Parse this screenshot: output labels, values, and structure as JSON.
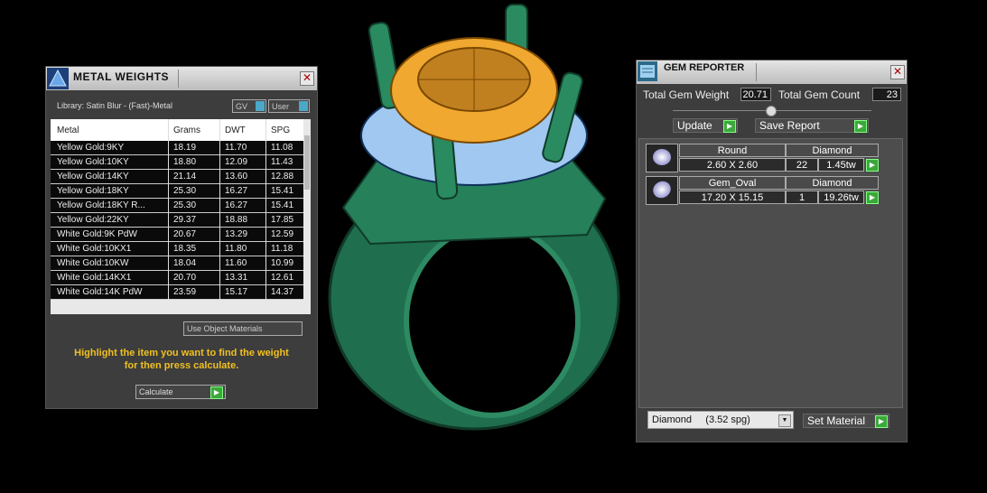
{
  "metal_weights": {
    "title": "METAL WEIGHTS",
    "library": "Library: Satin Blur - (Fast)-Metal",
    "gv_label": "GV",
    "user_label": "User",
    "columns": [
      "Metal",
      "Grams",
      "DWT",
      "SPG"
    ],
    "rows": [
      [
        "Yellow Gold:9KY",
        "18.19",
        "11.70",
        "11.08"
      ],
      [
        "Yellow Gold:10KY",
        "18.80",
        "12.09",
        "11.43"
      ],
      [
        "Yellow Gold:14KY",
        "21.14",
        "13.60",
        "12.88"
      ],
      [
        "Yellow Gold:18KY",
        "25.30",
        "16.27",
        "15.41"
      ],
      [
        "Yellow Gold:18KY R...",
        "25.30",
        "16.27",
        "15.41"
      ],
      [
        "Yellow Gold:22KY",
        "29.37",
        "18.88",
        "17.85"
      ],
      [
        "White Gold:9K PdW",
        "20.67",
        "13.29",
        "12.59"
      ],
      [
        "White Gold:10KX1",
        "18.35",
        "11.80",
        "11.18"
      ],
      [
        "White Gold:10KW",
        "18.04",
        "11.60",
        "10.99"
      ],
      [
        "White Gold:14KX1",
        "20.70",
        "13.31",
        "12.61"
      ],
      [
        "White Gold:14K PdW",
        "23.59",
        "15.17",
        "14.37"
      ]
    ],
    "use_object_materials": "Use Object Materials",
    "help_line1": "Highlight the item you want to find the weight",
    "help_line2": "for then press calculate.",
    "calculate_label": "Calculate"
  },
  "gem_reporter": {
    "title": "GEM REPORTER",
    "total_weight_label": "Total Gem Weight",
    "total_weight_value": "20.71",
    "total_count_label": "Total Gem Count",
    "total_count_value": "23",
    "update_label": "Update",
    "save_report_label": "Save Report",
    "gems": [
      {
        "shape": "Round",
        "material": "Diamond",
        "size": "2.60 X 2.60",
        "count": "22",
        "weight": "1.45tw"
      },
      {
        "shape": "Gem_Oval",
        "material": "Diamond",
        "size": "17.20 X 15.15",
        "count": "1",
        "weight": "19.26tw"
      }
    ],
    "material_select": "Diamond     (3.52 spg)",
    "set_material_label": "Set Material"
  },
  "colors": {
    "ring_green": "#1f6e4e",
    "gem_orange": "#f0a830",
    "small_gems": "#a0c8f0",
    "help_text": "#f0c020"
  }
}
